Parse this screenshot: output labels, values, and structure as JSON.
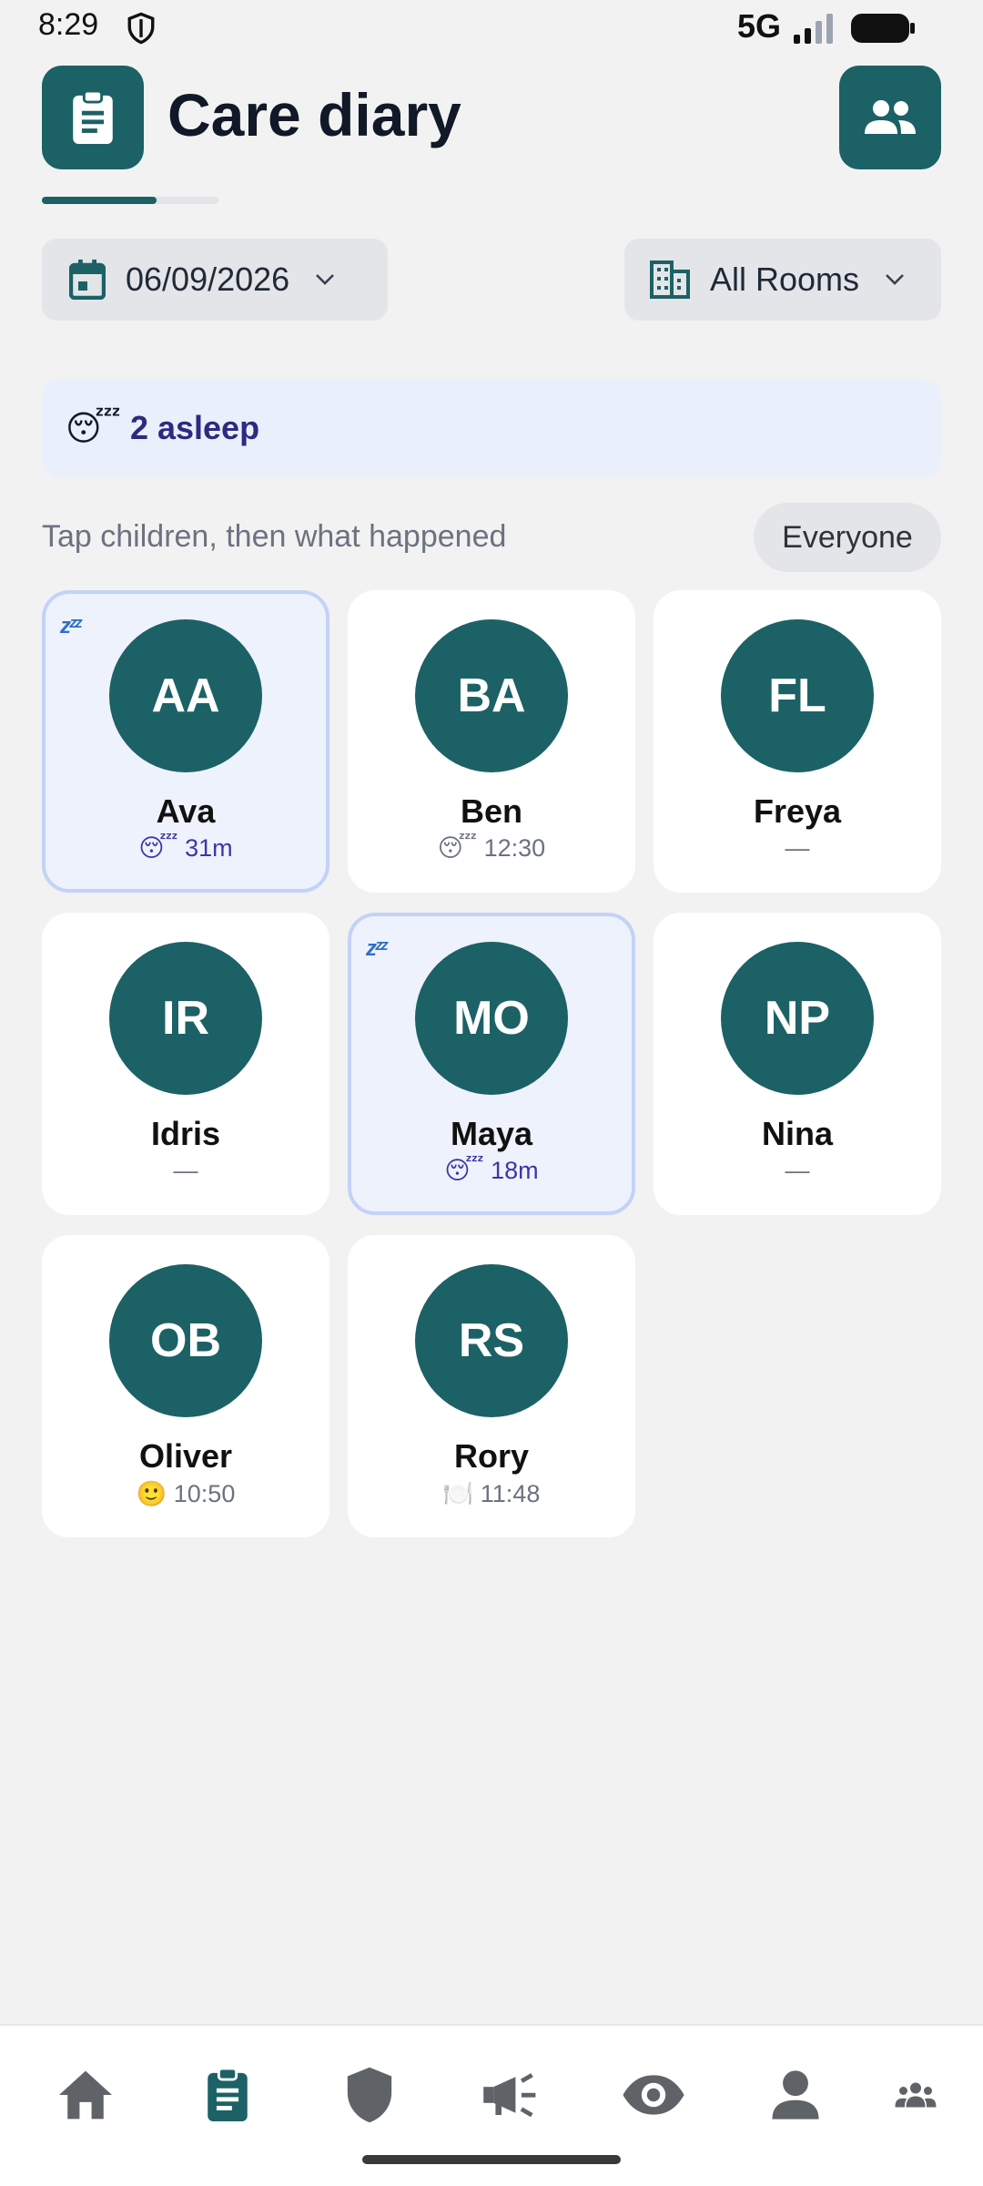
{
  "status_bar": {
    "time": "8:29",
    "network": "5G"
  },
  "header": {
    "title": "Care diary"
  },
  "progress": {
    "fraction": 0.65
  },
  "filters": {
    "date": "06/09/2026",
    "room": "All Rooms"
  },
  "banner": {
    "emoji": "😴",
    "text": "2 asleep"
  },
  "hint": "Tap children, then what happened",
  "everyone_label": "Everyone",
  "children": [
    {
      "initials": "AA",
      "name": "Ava",
      "status": "😴 31m",
      "asleep": true
    },
    {
      "initials": "BA",
      "name": "Ben",
      "status": "😴 12:30",
      "asleep": false
    },
    {
      "initials": "FL",
      "name": "Freya",
      "status": "—",
      "asleep": false
    },
    {
      "initials": "IR",
      "name": "Idris",
      "status": "—",
      "asleep": false
    },
    {
      "initials": "MO",
      "name": "Maya",
      "status": "😴 18m",
      "asleep": true
    },
    {
      "initials": "NP",
      "name": "Nina",
      "status": "—",
      "asleep": false
    },
    {
      "initials": "OB",
      "name": "Oliver",
      "status": "🙂 10:50",
      "asleep": false
    },
    {
      "initials": "RS",
      "name": "Rory",
      "status": "🍽️ 11:48",
      "asleep": false
    }
  ],
  "colors": {
    "brand": "#1c6166",
    "asleep_bg": "#eef2fd",
    "asleep_border": "#c4d2f7",
    "nav_active": "#1c6166",
    "nav_inactive": "#5f6368"
  },
  "nav_icons": [
    "home-icon",
    "clipboard-icon",
    "shield-icon",
    "megaphone-icon",
    "eye-icon",
    "person-icon",
    "group-icon"
  ]
}
